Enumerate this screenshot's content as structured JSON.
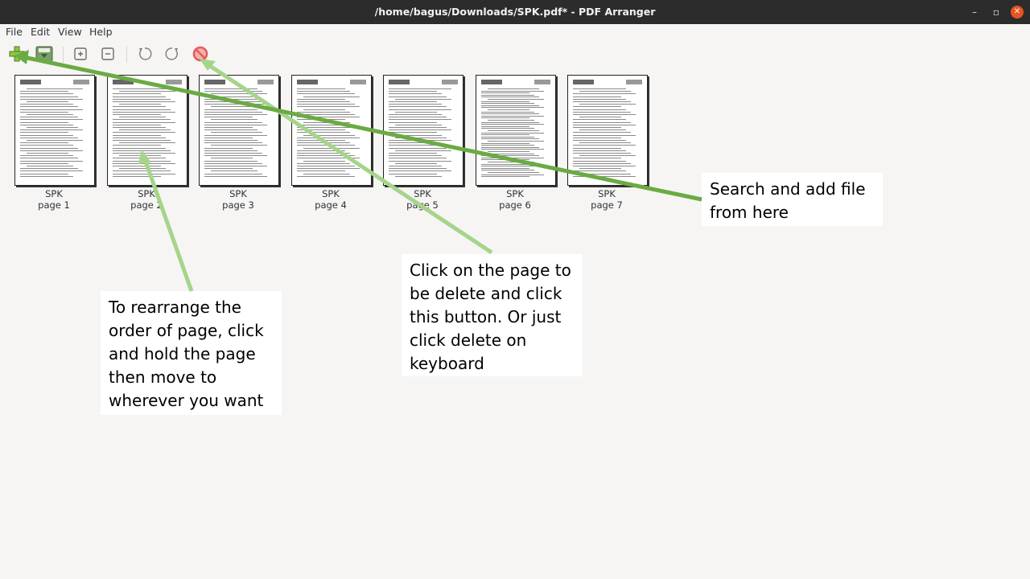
{
  "window": {
    "title": "/home/bagus/Downloads/SPK.pdf* - PDF Arranger",
    "minimize": "–",
    "maximize": "▫",
    "close": "✕"
  },
  "menu": [
    "File",
    "Edit",
    "View",
    "Help"
  ],
  "toolbar": {
    "buttons": [
      {
        "name": "add-file-icon"
      },
      {
        "name": "save-icon"
      },
      {
        "name": "zoom-in-icon"
      },
      {
        "name": "zoom-out-icon"
      },
      {
        "name": "rotate-left-icon"
      },
      {
        "name": "rotate-right-icon"
      },
      {
        "name": "delete-icon"
      }
    ]
  },
  "pages": [
    {
      "file": "SPK",
      "label": "page 1"
    },
    {
      "file": "SPK",
      "label": "page 2"
    },
    {
      "file": "SPK",
      "label": "page 3"
    },
    {
      "file": "SPK",
      "label": "page 4"
    },
    {
      "file": "SPK",
      "label": "page 5"
    },
    {
      "file": "SPK",
      "label": "page 6"
    },
    {
      "file": "SPK",
      "label": "page 7"
    }
  ],
  "annotations": {
    "add_file": "Search and add file from here",
    "delete": "Click on the page to be delete and click this button. Or just click delete on keyboard",
    "rearrange": "To rearrange the order of page, click and hold the page then move to wherever you want"
  },
  "colors": {
    "arrow_dark": "#6aab43",
    "arrow_light": "#a5d58a",
    "delete_icon": "#e35d5d",
    "close_button": "#e95420"
  }
}
